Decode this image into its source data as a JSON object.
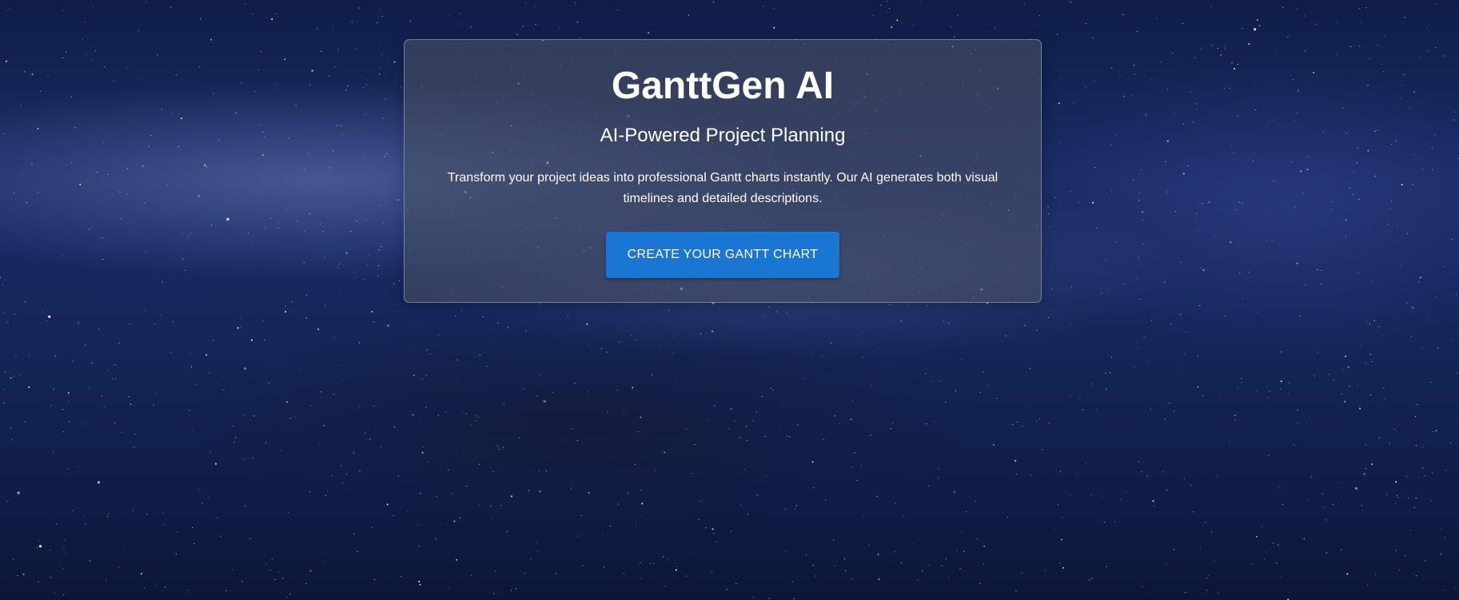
{
  "hero": {
    "title": "GanttGen AI",
    "subtitle": "AI-Powered Project Planning",
    "description": "Transform your project ideas into professional Gantt charts instantly. Our AI generates both visual timelines and detailed descriptions.",
    "cta_label": "CREATE YOUR GANTT CHART"
  },
  "theme": {
    "accent": "#1976d2",
    "card_background": "#485064",
    "text_color": "#ffffff",
    "background_style": "starry night sky"
  }
}
